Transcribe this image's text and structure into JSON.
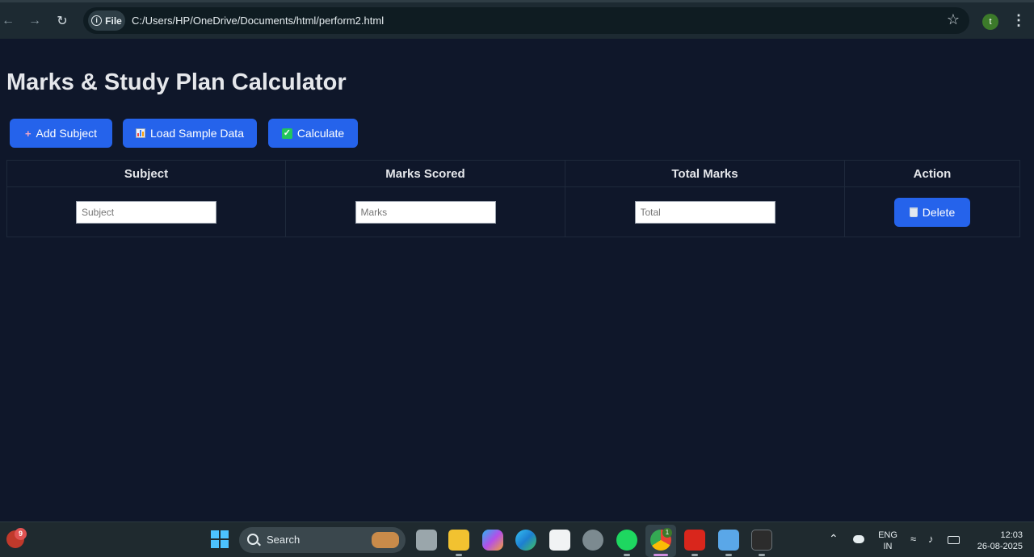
{
  "browser": {
    "file_chip": "File",
    "url": "C:/Users/HP/OneDrive/Documents/html/perform2.html",
    "profile_initial": "t"
  },
  "page": {
    "title": "Marks & Study Plan Calculator",
    "buttons": {
      "add_subject": "Add Subject",
      "load_sample": "Load Sample Data",
      "calculate": "Calculate"
    },
    "table": {
      "headers": [
        "Subject",
        "Marks Scored",
        "Total Marks",
        "Action"
      ],
      "rows": [
        {
          "subject": {
            "value": "",
            "placeholder": "Subject"
          },
          "marks": {
            "value": "",
            "placeholder": "Marks"
          },
          "total": {
            "value": "",
            "placeholder": "Total"
          },
          "action_label": "Delete"
        }
      ]
    }
  },
  "taskbar": {
    "notification_count": "9",
    "search_label": "Search",
    "chrome_badge": "1",
    "language": "ENG",
    "region": "IN",
    "time": "12:03",
    "date": "26-08-2025"
  },
  "colors": {
    "page_background": "#0f172a",
    "button": "#2563eb"
  }
}
